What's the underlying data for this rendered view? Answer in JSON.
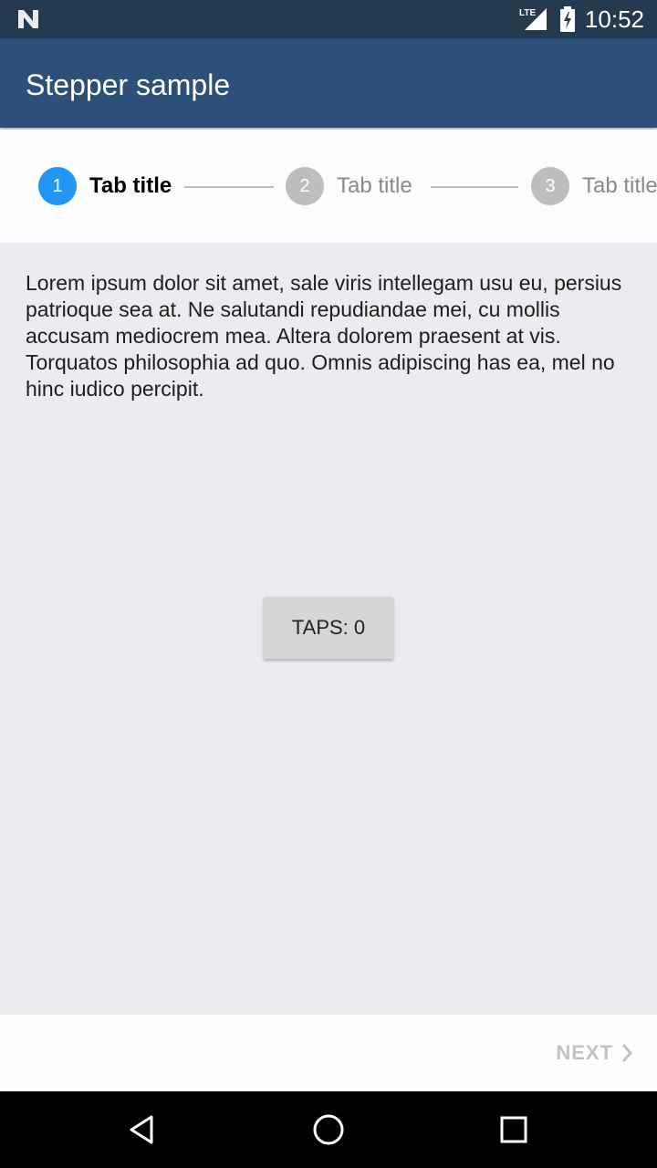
{
  "status_bar": {
    "time": "10:52",
    "network_label": "LTE",
    "icons": [
      "n-logo-icon",
      "lte-signal-icon",
      "battery-charging-icon"
    ]
  },
  "app_bar": {
    "title": "Stepper sample"
  },
  "stepper": {
    "steps": [
      {
        "number": "1",
        "label": "Tab title",
        "active": true
      },
      {
        "number": "2",
        "label": "Tab title",
        "active": false
      },
      {
        "number": "3",
        "label": "Tab title",
        "active": false
      }
    ]
  },
  "content": {
    "text": "Lorem ipsum dolor sit amet, sale viris intellegam usu eu, persius patrioque sea at. Ne salutandi repudiandae mei, cu mollis accusam mediocrem mea. Altera dolorem praesent at vis. Torquatos philosophia ad quo. Omnis adipiscing has ea, mel no hinc iudico percipit.",
    "taps_button": "TAPS: 0"
  },
  "bottom_nav": {
    "next_label": "NEXT",
    "next_enabled": false
  },
  "colors": {
    "status_bar": "#243a51",
    "app_bar": "#2c5077",
    "active_step": "#2196f3",
    "inactive_step": "#bdbdbd"
  }
}
